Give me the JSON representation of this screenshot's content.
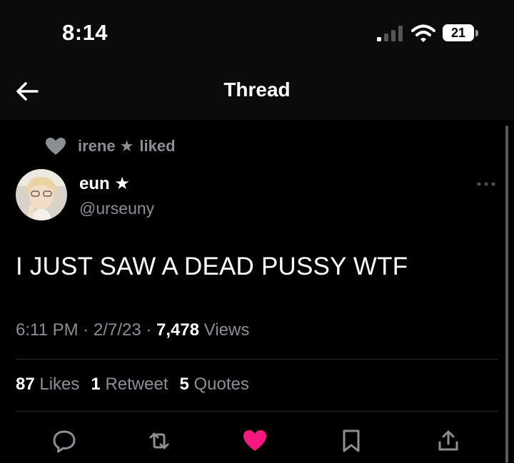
{
  "status_bar": {
    "time": "8:14",
    "battery": "21"
  },
  "nav": {
    "title": "Thread"
  },
  "social_context": {
    "user": "irene ★",
    "action": "liked"
  },
  "tweet": {
    "display_name": "eun ★",
    "handle": "@urseuny",
    "text": "I JUST SAW A DEAD PUSSY WTF",
    "time": "6:11 PM",
    "date": "2/7/23",
    "views_count": "7,478",
    "views_label": "Views",
    "separator": "·"
  },
  "stats": {
    "likes_count": "87",
    "likes_label": "Likes",
    "retweets_count": "1",
    "retweets_label": "Retweet",
    "quotes_count": "5",
    "quotes_label": "Quotes"
  },
  "colors": {
    "background": "#000000",
    "secondary_text": "#8b8f94",
    "like_accent": "#f91880",
    "divider": "#2a2d30"
  },
  "icons": {
    "back": "arrow-left-icon",
    "more": "more-horizontal-icon",
    "reply": "reply-icon",
    "retweet": "retweet-icon",
    "like": "heart-icon",
    "bookmark": "bookmark-icon",
    "share": "share-icon"
  }
}
